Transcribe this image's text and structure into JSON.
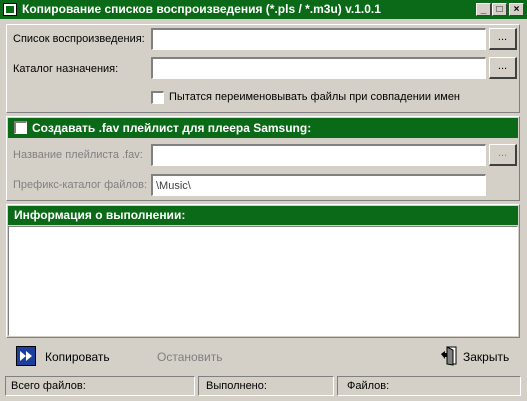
{
  "window": {
    "title": "Копирование списков воспроизведения (*.pls / *.m3u) v.1.0.1",
    "controls": [
      "_",
      "□",
      "×"
    ]
  },
  "paths": {
    "playlist_label": "Список воспроизведения:",
    "playlist_value": "",
    "dest_label": "Каталог назначения:",
    "dest_value": "",
    "browse_label": "...",
    "rename_label": "Пытатся переименовывать файлы  при совпадении имен",
    "rename_checked": false
  },
  "fav": {
    "header_label": "Создавать .fav плейлист для плеера Samsung:",
    "header_checked": false,
    "name_label": "Название плейлиста .fav:",
    "name_value": "",
    "browse_label": "...",
    "prefix_label": "Префикс-каталог файлов:",
    "prefix_value": "\\Music\\"
  },
  "info": {
    "header_label": "Информация о выполнении:",
    "log": ""
  },
  "actions": {
    "copy_label": "Копировать",
    "stop_label": "Остановить",
    "close_label": "Закрыть"
  },
  "status": {
    "total_label": "Всего файлов:",
    "total_value": "",
    "done_label": "Выполнено:",
    "done_value": "",
    "files_label": "Файлов:",
    "files_value": ""
  },
  "colors": {
    "accent_green": "#0b6a17",
    "window_bg": "#d4d0c8",
    "play_icon_blue": "#1b3f9c"
  },
  "icons": {
    "app": "app-window-icon",
    "copy": "fast-forward-icon",
    "close": "door-exit-icon"
  }
}
